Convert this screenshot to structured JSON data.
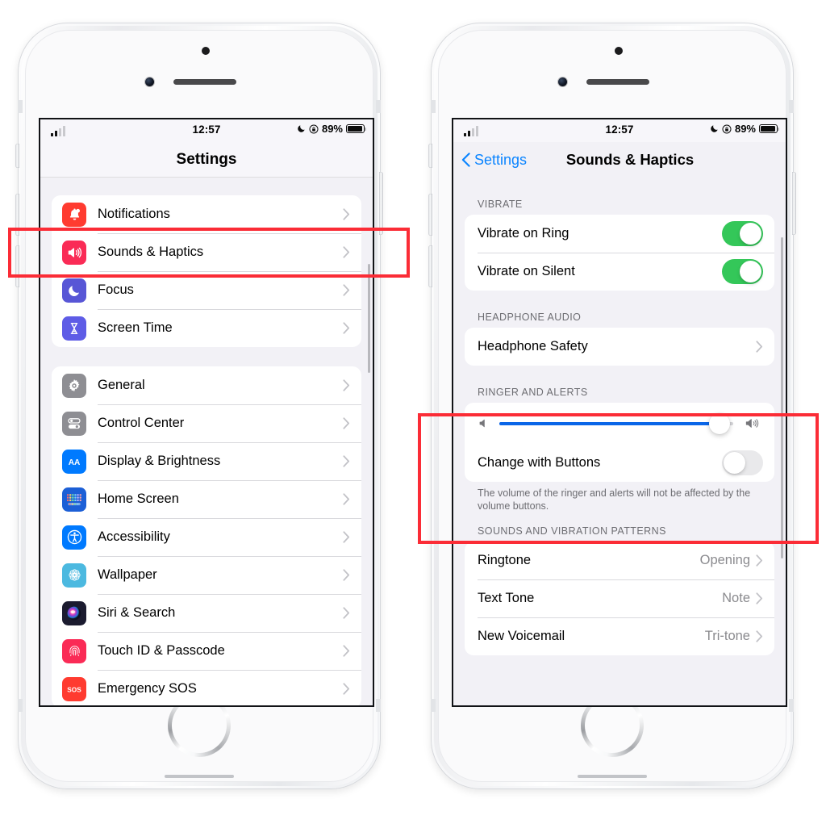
{
  "status_bar": {
    "time": "12:57",
    "battery_percent": "89%",
    "signal_icon": "cellular-signal-icon",
    "moon_icon": "do-not-disturb-moon-icon",
    "lock_icon": "rotation-lock-icon",
    "battery_icon": "battery-icon"
  },
  "left_phone": {
    "nav": {
      "title": "Settings"
    },
    "group1": [
      {
        "label": "Notifications",
        "icon": "notifications-bell-icon",
        "icon_color": "#ff3b30"
      },
      {
        "label": "Sounds & Haptics",
        "icon": "sounds-speaker-icon",
        "icon_color": "#fa2b56"
      },
      {
        "label": "Focus",
        "icon": "focus-moon-icon",
        "icon_color": "#5856d6"
      },
      {
        "label": "Screen Time",
        "icon": "screen-time-hourglass-icon",
        "icon_color": "#5e5ce6"
      }
    ],
    "group2": [
      {
        "label": "General",
        "icon": "general-gear-icon",
        "icon_color": "#8e8e93"
      },
      {
        "label": "Control Center",
        "icon": "control-center-icon",
        "icon_color": "#8e8e93"
      },
      {
        "label": "Display & Brightness",
        "icon": "display-brightness-aa-icon",
        "icon_color": "#007aff"
      },
      {
        "label": "Home Screen",
        "icon": "home-screen-grid-icon",
        "icon_color": "#1c5fd6"
      },
      {
        "label": "Accessibility",
        "icon": "accessibility-icon",
        "icon_color": "#007aff"
      },
      {
        "label": "Wallpaper",
        "icon": "wallpaper-flower-icon",
        "icon_color": "#4cb9e0"
      },
      {
        "label": "Siri & Search",
        "icon": "siri-search-icon",
        "icon_color": "#1b1b2f"
      },
      {
        "label": "Touch ID & Passcode",
        "icon": "touch-id-fingerprint-icon",
        "icon_color": "#fa2b56"
      },
      {
        "label": "Emergency SOS",
        "icon": "emergency-sos-icon",
        "icon_color": "#ff3b30"
      }
    ]
  },
  "right_phone": {
    "nav": {
      "back_label": "Settings",
      "title": "Sounds & Haptics"
    },
    "vibrate": {
      "header": "VIBRATE",
      "rows": [
        {
          "label": "Vibrate on Ring",
          "toggle": "on"
        },
        {
          "label": "Vibrate on Silent",
          "toggle": "on"
        }
      ]
    },
    "headphone_audio": {
      "header": "HEADPHONE AUDIO",
      "rows": [
        {
          "label": "Headphone Safety"
        }
      ]
    },
    "ringer_and_alerts": {
      "header": "RINGER AND ALERTS",
      "slider": {
        "value_percent": 94,
        "low_icon": "speaker-low-icon",
        "high_icon": "speaker-high-icon"
      },
      "toggle_row": {
        "label": "Change with Buttons",
        "toggle": "off"
      },
      "footer": "The volume of the ringer and alerts will not be affected by the volume buttons."
    },
    "sounds_patterns": {
      "header": "SOUNDS AND VIBRATION PATTERNS",
      "rows": [
        {
          "label": "Ringtone",
          "value": "Opening"
        },
        {
          "label": "Text Tone",
          "value": "Note"
        },
        {
          "label": "New Voicemail",
          "value": "Tri-tone"
        }
      ]
    }
  },
  "colors": {
    "accent_blue": "#0a84ff",
    "toggle_on_green": "#34c759",
    "slider_blue": "#0a66e8",
    "highlight_red": "#fb2c36"
  }
}
